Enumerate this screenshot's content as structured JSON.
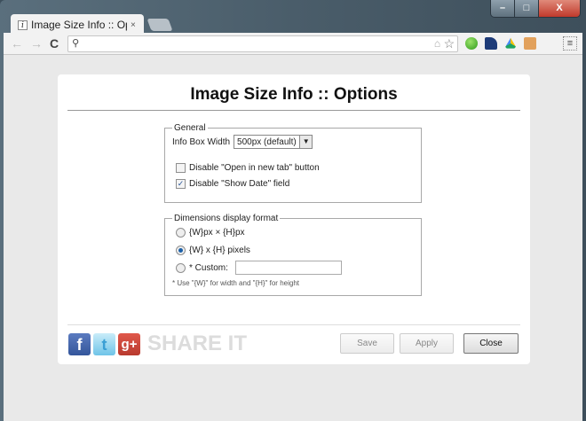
{
  "browser": {
    "tab_title": "Image Size Info :: Options",
    "tab_close": "×",
    "favicon": "i",
    "window_buttons": {
      "minimize": "–",
      "maximize": "□",
      "close": "X"
    },
    "nav": {
      "back": "←",
      "forward": "→",
      "reload": "C"
    },
    "omnibox_value": "",
    "menu": "≡"
  },
  "page": {
    "title": "Image Size Info :: Options",
    "general": {
      "legend": "General",
      "info_box_width_label": "Info Box Width",
      "info_box_width_value": "500px (default)",
      "checkboxes": [
        {
          "label": "Disable \"Open in new tab\" button",
          "checked": false
        },
        {
          "label": "Disable \"Show Date\" field",
          "checked": true
        }
      ]
    },
    "dimensions": {
      "legend": "Dimensions display format",
      "options": [
        {
          "label": "{W}px × {H}px",
          "selected": false
        },
        {
          "label": "{W} x {H} pixels",
          "selected": true
        },
        {
          "label": "* Custom:",
          "selected": false
        }
      ],
      "custom_value": "",
      "note": "* Use \"{W}\" for width and \"{H}\" for height"
    },
    "share": {
      "label": "SHARE IT",
      "facebook": "f",
      "twitter": "t",
      "googleplus": "g+"
    },
    "buttons": {
      "save": "Save",
      "apply": "Apply",
      "close": "Close"
    }
  }
}
